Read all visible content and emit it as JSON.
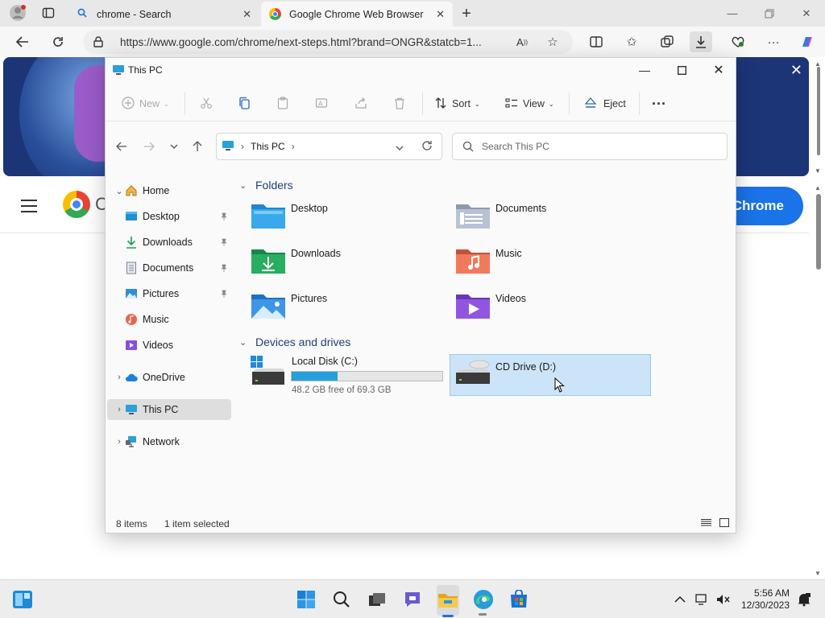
{
  "browser": {
    "tabs": [
      {
        "label": "chrome - Search",
        "active": false
      },
      {
        "label": "Google Chrome Web Browser",
        "active": true
      }
    ],
    "url": "https://www.google.com/chrome/next-steps.html?brand=ONGR&statcb=1..."
  },
  "page": {
    "brand_partial": "C",
    "cta_label": "Chrome"
  },
  "explorer": {
    "title": "This PC",
    "commands": {
      "new": "New",
      "sort": "Sort",
      "view": "View",
      "eject": "Eject",
      "more": "···"
    },
    "breadcrumb": "This PC",
    "search_placeholder": "Search This PC",
    "sidebar": [
      {
        "label": "Home"
      },
      {
        "label": "Desktop"
      },
      {
        "label": "Downloads"
      },
      {
        "label": "Documents"
      },
      {
        "label": "Pictures"
      },
      {
        "label": "Music"
      },
      {
        "label": "Videos"
      },
      {
        "label": "OneDrive"
      },
      {
        "label": "This PC"
      },
      {
        "label": "Network"
      }
    ],
    "sections": {
      "folders": "Folders",
      "devices": "Devices and drives"
    },
    "folders": [
      {
        "label": "Desktop"
      },
      {
        "label": "Documents"
      },
      {
        "label": "Downloads"
      },
      {
        "label": "Music"
      },
      {
        "label": "Pictures"
      },
      {
        "label": "Videos"
      }
    ],
    "drives": [
      {
        "label": "Local Disk (C:)",
        "free_text": "48.2 GB free of 69.3 GB",
        "used_fraction": 0.305
      },
      {
        "label": "CD Drive (D:)"
      }
    ],
    "status": {
      "items": "8 items",
      "selected": "1 item selected"
    }
  },
  "taskbar": {
    "time": "5:56 AM",
    "date": "12/30/2023"
  },
  "colors": {
    "accent": "#1a73e8",
    "selection": "#cce4f7",
    "drive_bar": "#26a0da"
  }
}
